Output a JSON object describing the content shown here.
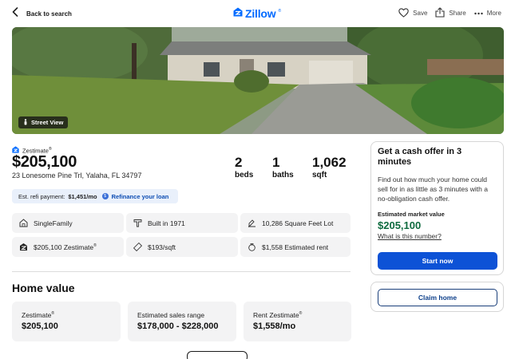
{
  "header": {
    "back_label": "Back to search",
    "logo_text": "Zillow",
    "save_label": "Save",
    "share_label": "Share",
    "more_label": "More"
  },
  "photo": {
    "street_view_label": "Street View"
  },
  "listing": {
    "zestimate_label": "Zestimate",
    "zestimate_reg": "®",
    "price": "$205,100",
    "address": "23 Lonesome Pine Trl, Yalaha, FL 34797",
    "beds_value": "2",
    "beds_label": "beds",
    "baths_value": "1",
    "baths_label": "baths",
    "sqft_value": "1,062",
    "sqft_label": "sqft"
  },
  "refi": {
    "label": "Est. refi payment:",
    "amount": "$1,451/mo",
    "link": "Refinance your loan"
  },
  "facts": {
    "type": "SingleFamily",
    "built": "Built in 1971",
    "lot": "10,286 Square Feet Lot",
    "zestimate": "$205,100 Zestimate",
    "zestimate_reg": "®",
    "price_sqft": "$193/sqft",
    "rent": "$1,558 Estimated rent"
  },
  "home_value": {
    "title": "Home value",
    "cards": [
      {
        "label": "Zestimate",
        "reg": "®",
        "value": "$205,100"
      },
      {
        "label": "Estimated sales range",
        "reg": "",
        "value": "$178,000 - $228,000"
      },
      {
        "label": "Rent Zestimate",
        "reg": "®",
        "value": "$1,558/mo"
      }
    ]
  },
  "cash_offer": {
    "title": "Get a cash offer in 3 minutes",
    "description": "Find out how much your home could sell for in as little as 3 minutes with a no-obligation cash offer.",
    "market_value_label": "Estimated market value",
    "market_value": "$205,100",
    "what_link": "What is this number?",
    "start_button": "Start now"
  },
  "claim": {
    "button": "Claim home"
  },
  "colors": {
    "brand_blue": "#006aff",
    "button_blue": "#0d52d6",
    "value_green": "#0f6b3f"
  }
}
